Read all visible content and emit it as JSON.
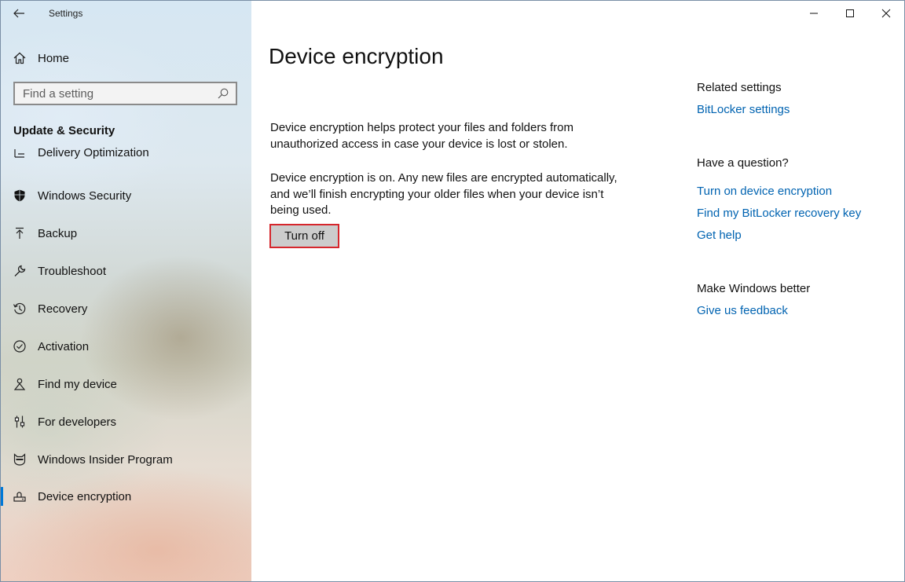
{
  "window": {
    "app_title": "Settings"
  },
  "sidebar": {
    "home_label": "Home",
    "search_placeholder": "Find a setting",
    "section_title": "Update & Security",
    "items": [
      {
        "label": "Delivery Optimization",
        "icon": "delivery-icon"
      },
      {
        "label": "Windows Security",
        "icon": "shield-icon"
      },
      {
        "label": "Backup",
        "icon": "backup-arrow-icon"
      },
      {
        "label": "Troubleshoot",
        "icon": "wrench-icon"
      },
      {
        "label": "Recovery",
        "icon": "history-icon"
      },
      {
        "label": "Activation",
        "icon": "check-circle-icon"
      },
      {
        "label": "Find my device",
        "icon": "person-pin-icon"
      },
      {
        "label": "For developers",
        "icon": "developer-sliders-icon"
      },
      {
        "label": "Windows Insider Program",
        "icon": "ninjacat-icon"
      },
      {
        "label": "Device encryption",
        "icon": "drive-lock-icon"
      }
    ],
    "selected_item": "Device encryption",
    "accent_color": "#0078d7"
  },
  "main": {
    "title": "Device encryption",
    "description": "Device encryption helps protect your files and folders from unauthorized access in case your device is lost or stolen.",
    "status": "Device encryption is on. Any new files are encrypted automatically, and we’ll finish encrypting your older files when your device isn’t being used.",
    "turn_off_label": "Turn off"
  },
  "related": {
    "related_heading": "Related settings",
    "bitlocker_link": "BitLocker settings",
    "question_heading": "Have a question?",
    "question_links": [
      "Turn on device encryption",
      "Find my BitLocker recovery key",
      "Get help"
    ],
    "better_heading": "Make Windows better",
    "feedback_link": "Give us feedback",
    "link_color": "#0063b1"
  },
  "highlight_color": "#d6262c"
}
